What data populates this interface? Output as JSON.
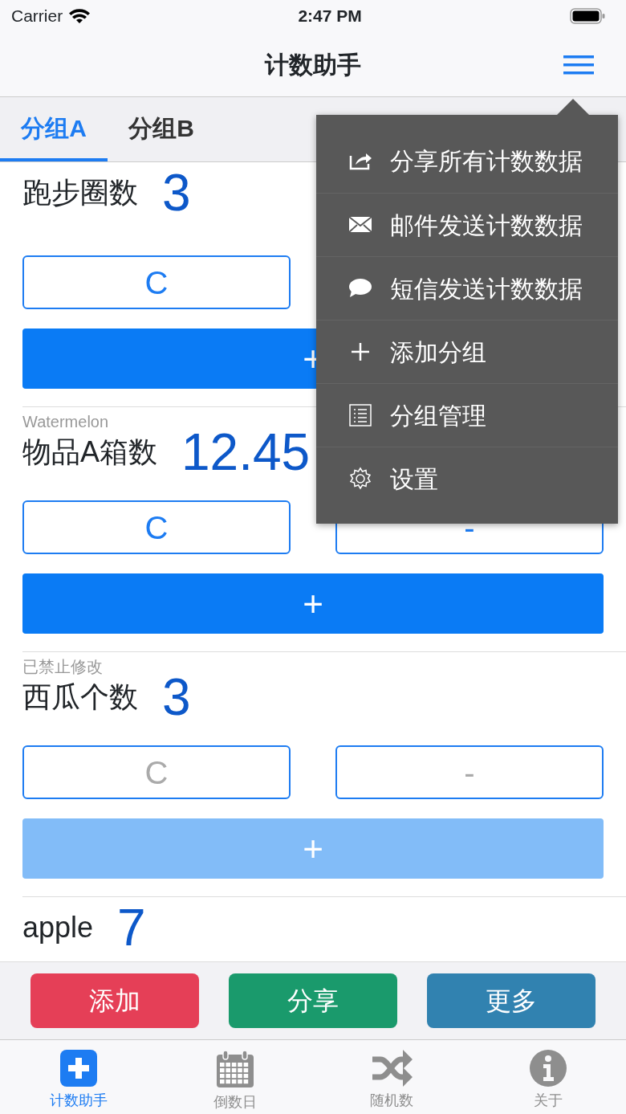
{
  "status_bar": {
    "carrier": "Carrier",
    "time": "2:47 PM"
  },
  "nav_bar": {
    "title": "计数助手"
  },
  "tabs": [
    {
      "label": "分组A",
      "selected": true
    },
    {
      "label": "分组B",
      "selected": false
    }
  ],
  "counters": [
    {
      "name": "跑步圈数",
      "value": "3",
      "disabled": false,
      "clear_label": "C",
      "plus_label": "+"
    },
    {
      "note": "Watermelon",
      "name": "物品A箱数",
      "value": "12.45",
      "disabled": false,
      "clear_label": "C",
      "minus_label": "-",
      "plus_label": "+"
    },
    {
      "note": "已禁止修改",
      "name": "西瓜个数",
      "value": "3",
      "disabled": true,
      "clear_label": "C",
      "minus_label": "-",
      "plus_label": "+"
    },
    {
      "name": "apple",
      "value": "7"
    }
  ],
  "actions": [
    {
      "label": "添加",
      "color": "#e53f57"
    },
    {
      "label": "分享",
      "color": "#1a9a6c"
    },
    {
      "label": "更多",
      "color": "#3182b0"
    }
  ],
  "tab_bar": [
    {
      "label": "计数助手",
      "kind": "plus",
      "selected": true
    },
    {
      "label": "倒数日",
      "kind": "calendar",
      "selected": false
    },
    {
      "label": "随机数",
      "kind": "shuffle",
      "selected": false
    },
    {
      "label": "关于",
      "kind": "info",
      "selected": false
    }
  ],
  "menu": [
    {
      "label": "分享所有计数数据",
      "kind": "share"
    },
    {
      "label": "邮件发送计数数据",
      "kind": "mail"
    },
    {
      "label": "短信发送计数数据",
      "kind": "chat"
    },
    {
      "label": "添加分组",
      "kind": "plus"
    },
    {
      "label": "分组管理",
      "kind": "list"
    },
    {
      "label": "设置",
      "kind": "gear"
    }
  ]
}
